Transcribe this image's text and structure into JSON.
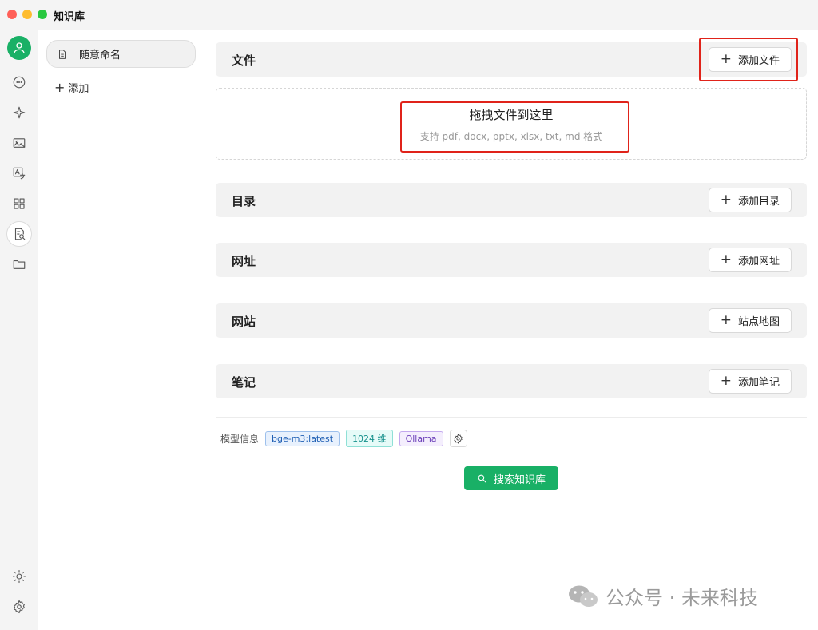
{
  "window": {
    "title": "知识库"
  },
  "iconbar": {
    "items": [
      "avatar-icon",
      "chat-icon",
      "sparkle-icon",
      "image-icon",
      "translate-icon",
      "apps-icon",
      "knowledge-icon",
      "folder-icon"
    ],
    "bottom": [
      "sun-icon",
      "gear-icon"
    ]
  },
  "sidebar": {
    "kb_item": "随意命名",
    "add_label": "添加"
  },
  "sections": {
    "file": {
      "title": "文件",
      "button": "添加文件"
    },
    "dropzone": {
      "title": "拖拽文件到这里",
      "subtitle": "支持 pdf, docx, pptx, xlsx, txt, md 格式"
    },
    "directory": {
      "title": "目录",
      "button": "添加目录"
    },
    "url": {
      "title": "网址",
      "button": "添加网址"
    },
    "website": {
      "title": "网站",
      "button": "站点地图"
    },
    "notes": {
      "title": "笔记",
      "button": "添加笔记"
    }
  },
  "model_info": {
    "label": "模型信息",
    "model": "bge-m3:latest",
    "dimensions": "1024 维",
    "provider": "Ollama"
  },
  "search_button": "搜索知识库",
  "watermark": "公众号 · 未来科技",
  "colors": {
    "accent": "#19b066",
    "highlight": "#e0231a"
  }
}
